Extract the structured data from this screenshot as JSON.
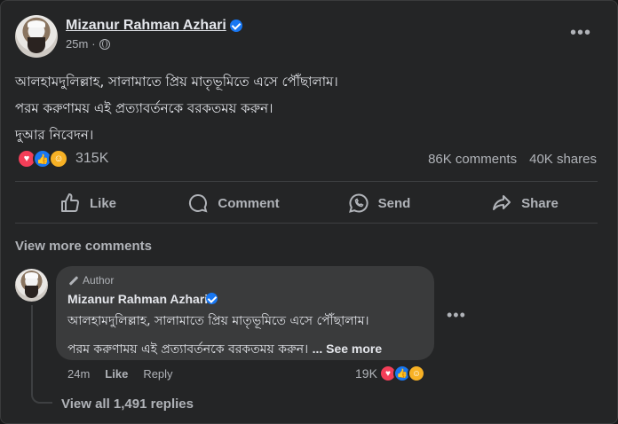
{
  "post": {
    "author": "Mizanur Rahman Azhari",
    "time": "25m",
    "lines": [
      "আলহামদুলিল্লাহ, সালামাতে প্রিয় মাতৃভূমিতে এসে পৌঁছালাম।",
      "পরম করুণাময় এই প্রত্যাবর্তনকে বরকতময় করুন।",
      "দুআর নিবেদন।"
    ],
    "reaction_count": "315K",
    "comments": "86K comments",
    "shares": "40K shares"
  },
  "actions": {
    "like": "Like",
    "comment": "Comment",
    "send": "Send",
    "share": "Share"
  },
  "view_more_comments": "View more comments",
  "comment": {
    "badge": "Author",
    "author": "Mizanur Rahman Azhari",
    "line1": "আলহামদুলিল্লাহ, সালামাতে প্রিয় মাতৃভূমিতে এসে পৌঁছালাম।",
    "line2": "পরম করুণাময় এই প্রত্যাবর্তনকে বরকতময় করুন।",
    "see_more": "... See more",
    "time": "24m",
    "like": "Like",
    "reply": "Reply",
    "reaction_count": "19K"
  },
  "view_replies": "View all 1,491 replies",
  "colors": {
    "background": "#242526",
    "bubble": "#3a3b3c",
    "accent": "#1877f2",
    "love": "#f33e58",
    "care": "#f7b125"
  }
}
